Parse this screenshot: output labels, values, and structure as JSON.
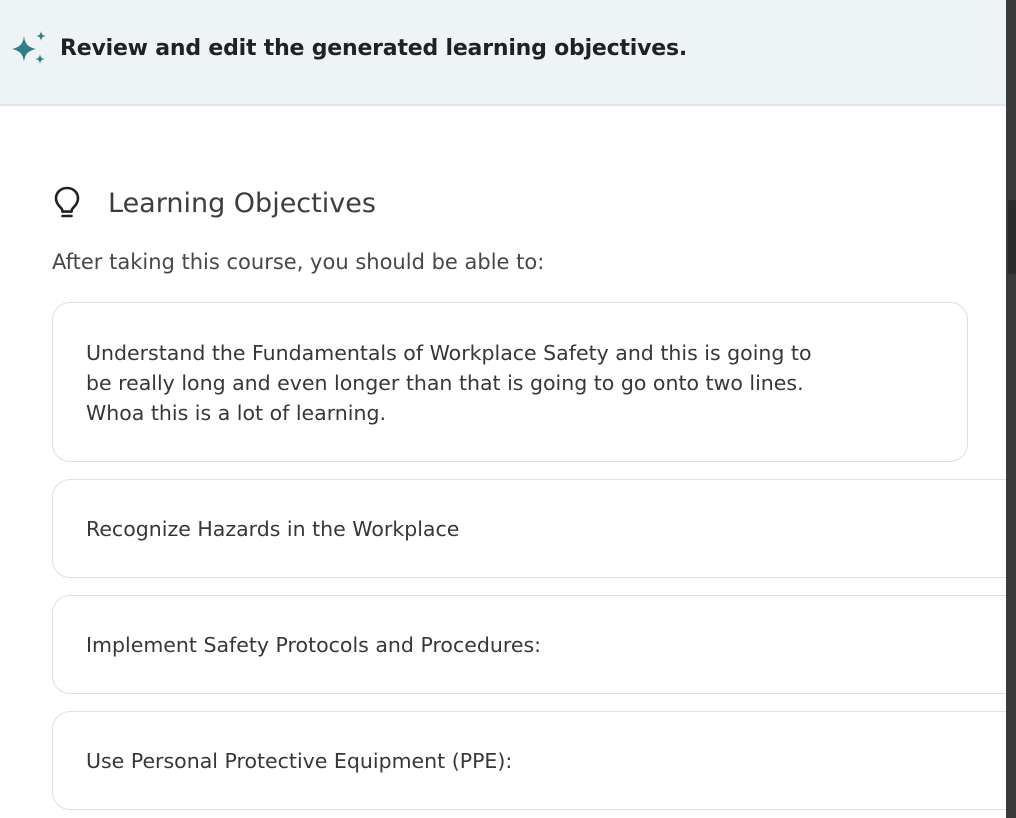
{
  "banner": {
    "icon": "sparkle-icon",
    "message": "Review and edit the generated learning objectives."
  },
  "section": {
    "icon": "lightbulb-icon",
    "title": "Learning Objectives",
    "intro": "After taking this course, you should be able to:"
  },
  "objectives": [
    "Understand the Fundamentals of Workplace Safety and this is going to\nbe really long and even longer than that is going to go onto two lines.\nWhoa this is a lot of learning.",
    "Recognize Hazards in the Workplace",
    "Implement Safety Protocols and Procedures:",
    "Use Personal Protective Equipment (PPE):"
  ],
  "colors": {
    "accent": "#2f7f85",
    "banner_bg": "#eef4f5",
    "card_border": "#dcdfe3"
  }
}
